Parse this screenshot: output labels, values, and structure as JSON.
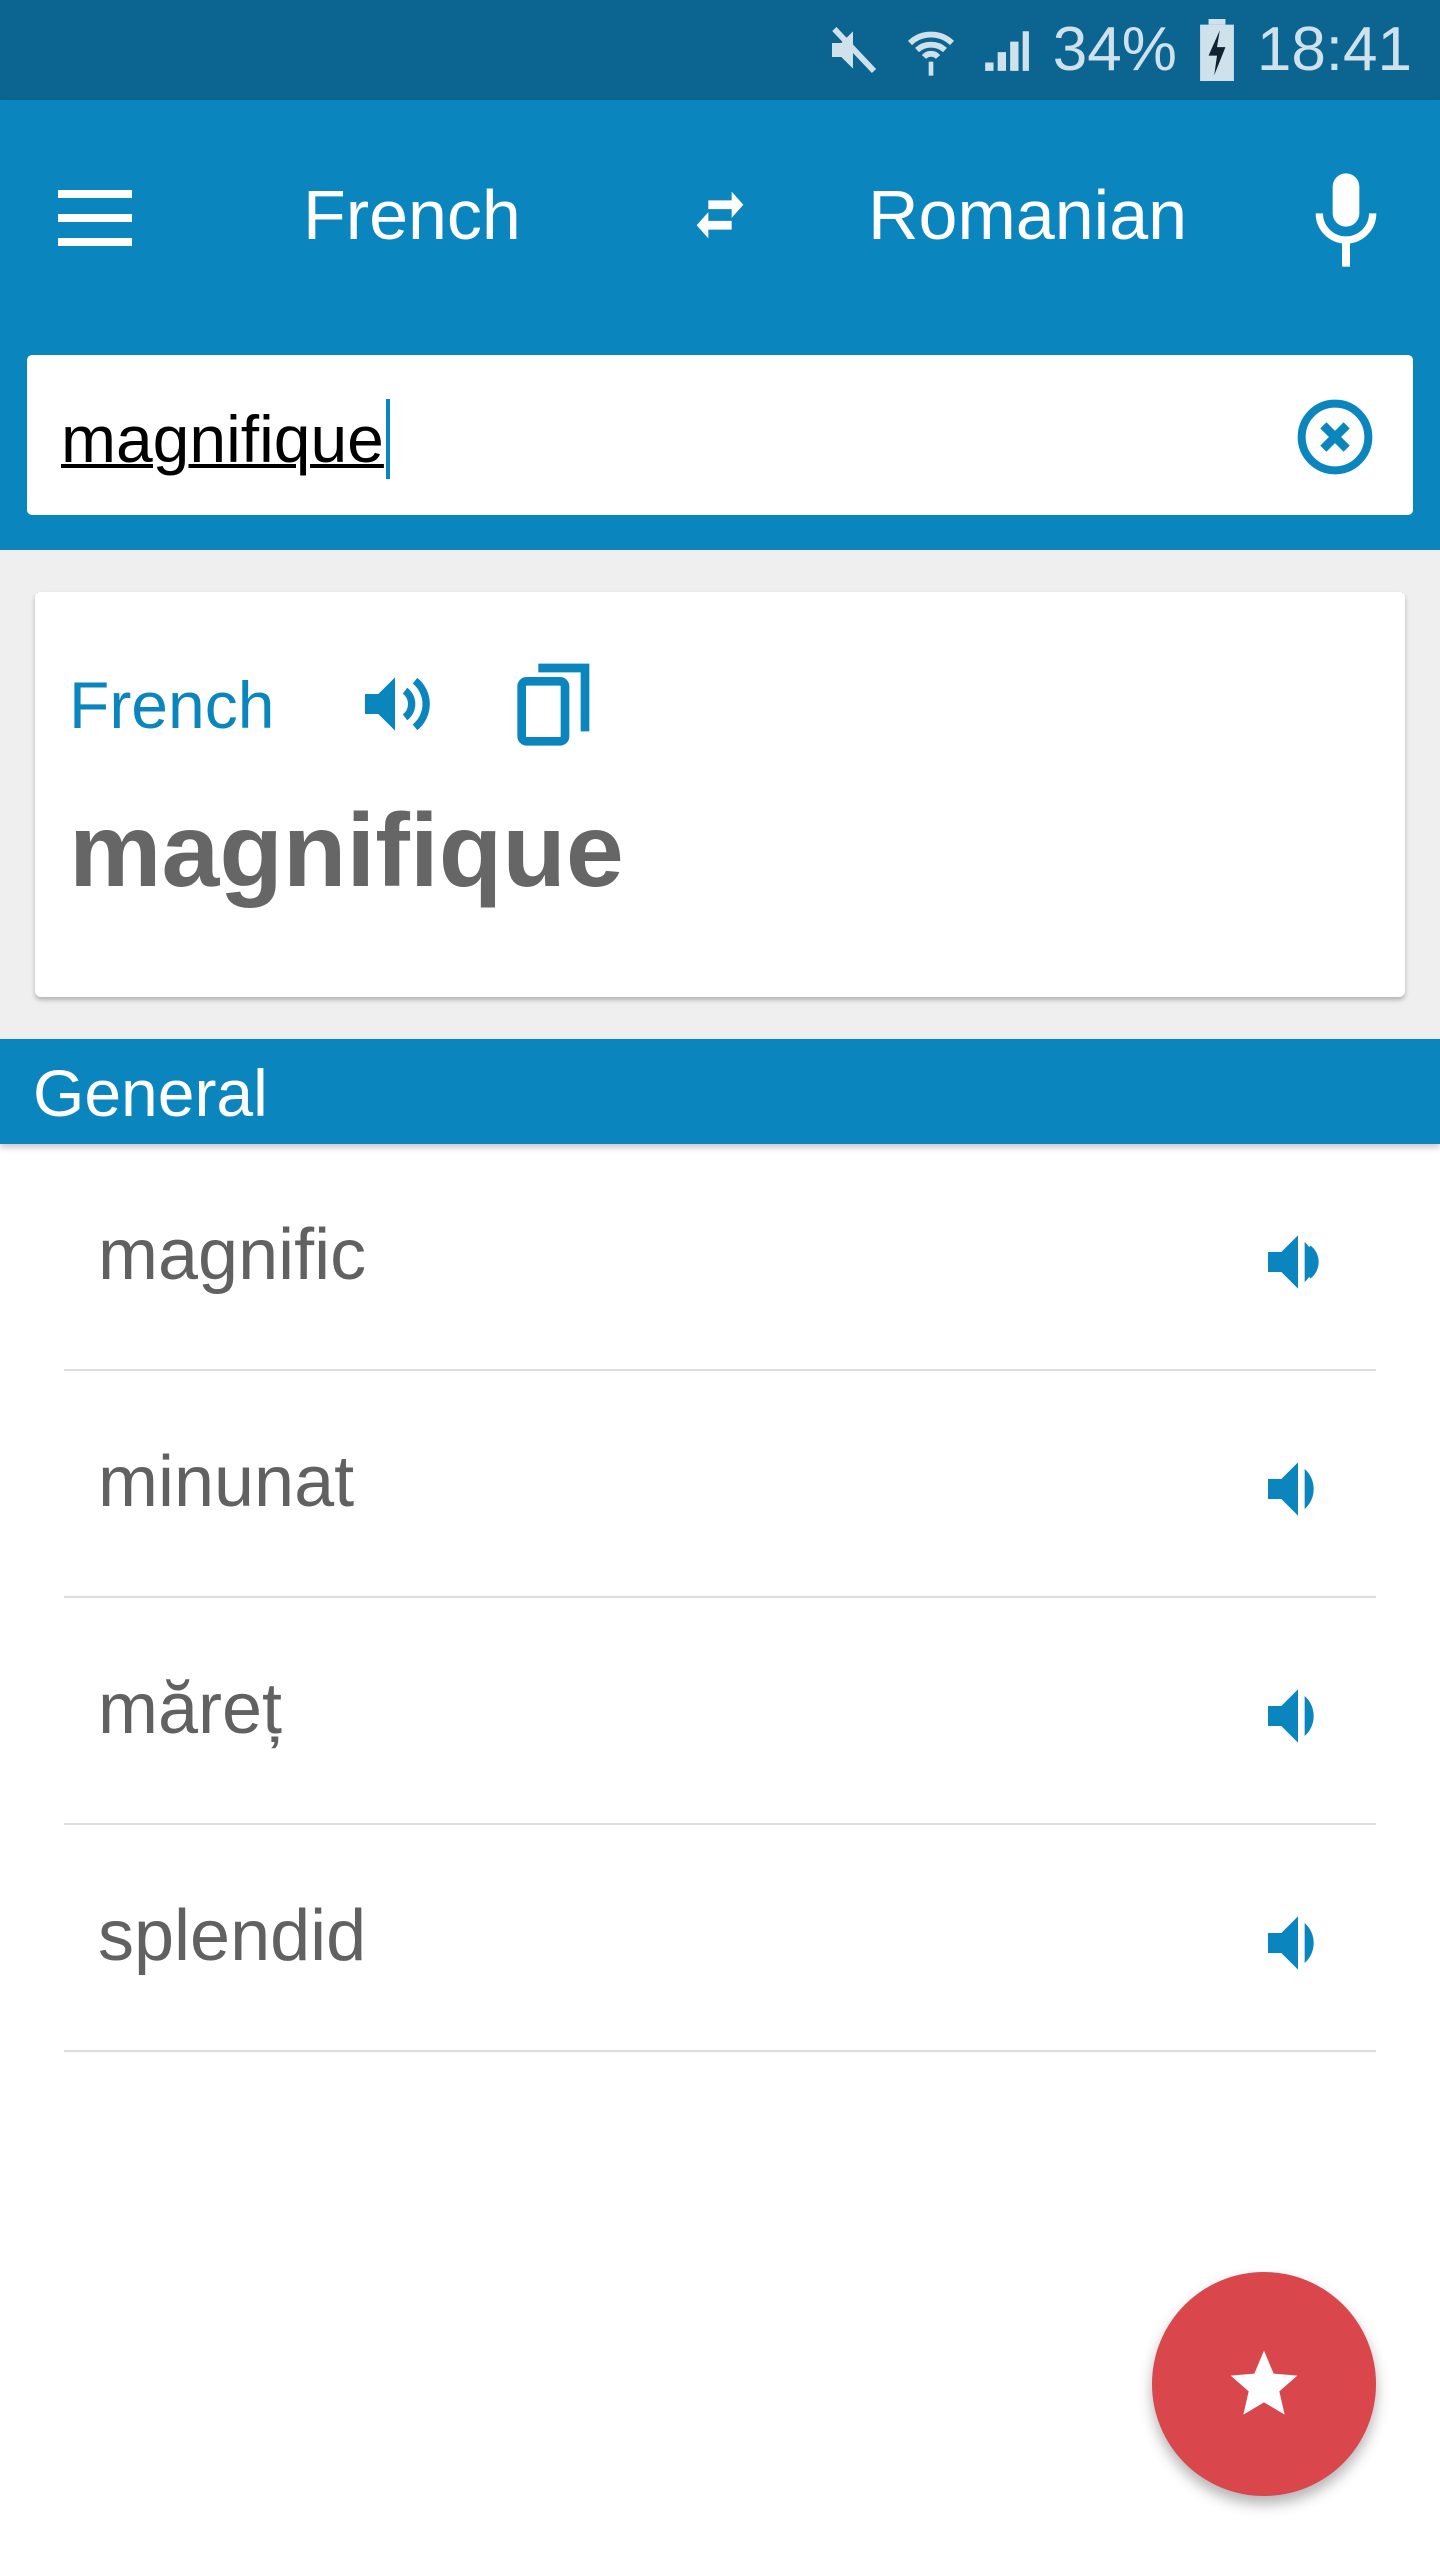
{
  "status_bar": {
    "battery": "34%",
    "time": "18:41"
  },
  "toolbar": {
    "source_language": "French",
    "target_language": "Romanian"
  },
  "search": {
    "value": "magnifique"
  },
  "result_card": {
    "language": "French",
    "word": "magnifique"
  },
  "section": {
    "title": "General"
  },
  "translations": [
    {
      "text": "magnific"
    },
    {
      "text": "minunat"
    },
    {
      "text": "măreț"
    },
    {
      "text": "splendid"
    }
  ],
  "colors": {
    "primary": "#0a85be",
    "status_bar": "#0b6590",
    "fab": "#d9464b"
  }
}
